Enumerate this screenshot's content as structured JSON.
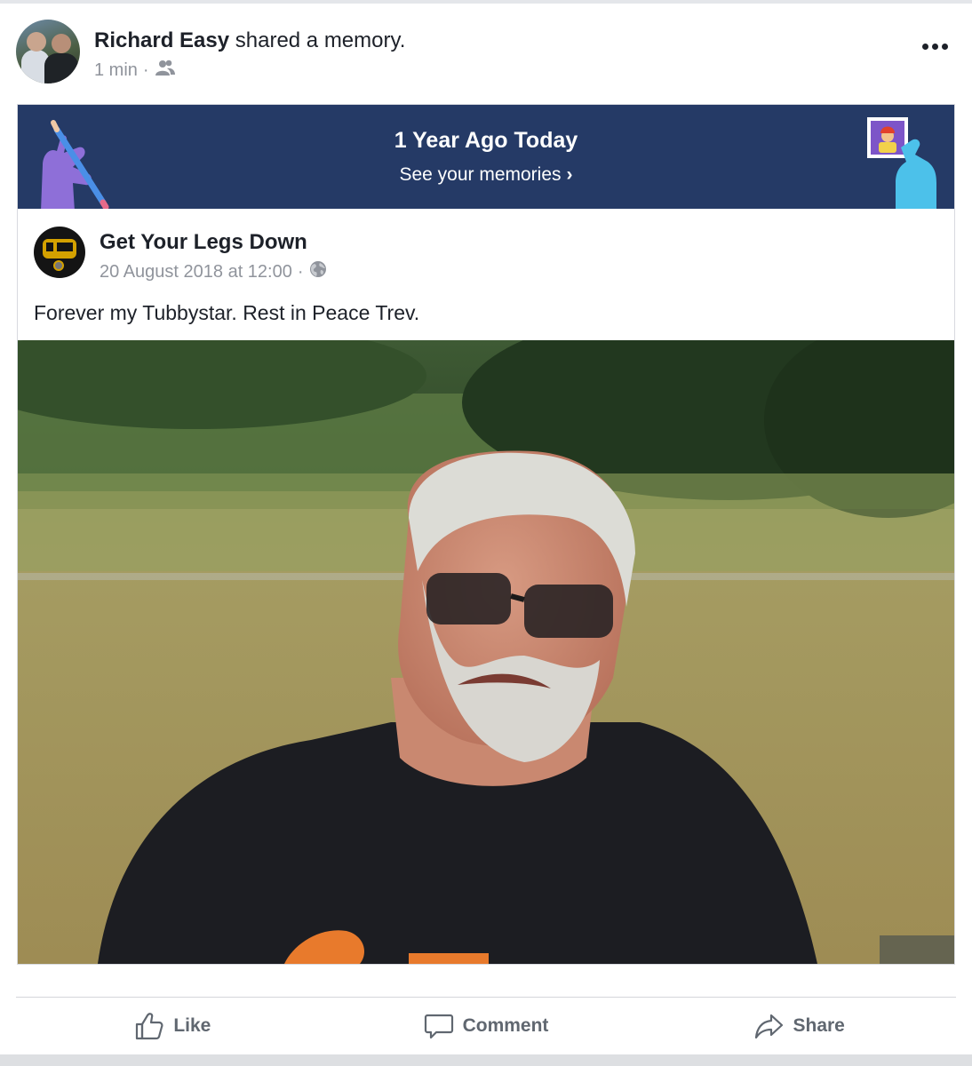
{
  "header": {
    "author": "Richard Easy",
    "action": "shared a memory.",
    "time": "1 min",
    "separator": "·",
    "privacy_icon": "friends-icon",
    "more_icon": "more-dots-icon"
  },
  "memory": {
    "title": "1 Year Ago Today",
    "link": "See your memories",
    "link_chevron": "›",
    "banner_color": "#253a66"
  },
  "original_post": {
    "page_name": "Get Your Legs Down",
    "date": "20 August 2018 at 12:00",
    "separator": "·",
    "privacy_icon": "globe-icon",
    "text": "Forever my Tubbystar. Rest in Peace Trev."
  },
  "actions": {
    "like": "Like",
    "comment": "Comment",
    "share": "Share"
  }
}
